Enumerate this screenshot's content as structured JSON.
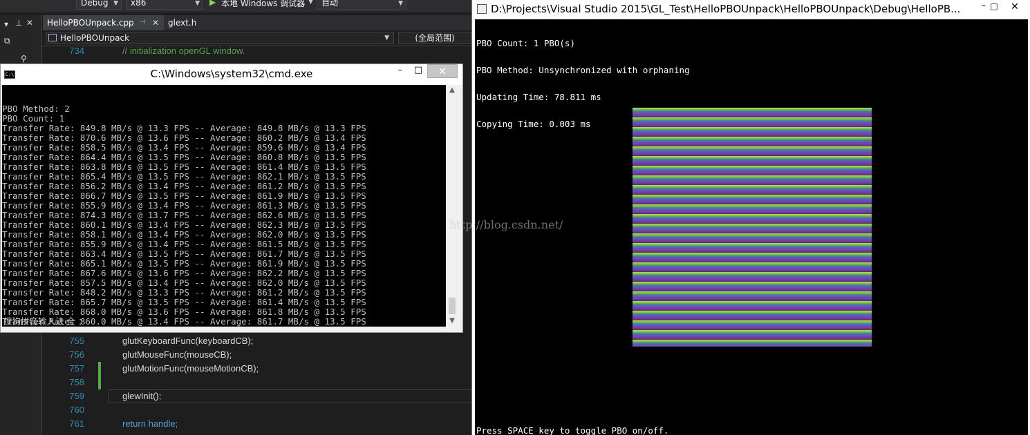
{
  "vs": {
    "toolbar": {
      "config": "Debug",
      "platform": "x86",
      "debugger": "本地 Windows 调试器",
      "auto": "自动"
    },
    "tabs": [
      {
        "label": "HelloPBOUnpack.cpp"
      },
      {
        "label": "glext.h"
      }
    ],
    "nav": {
      "project": "HelloPBOUnpack",
      "scope": "(全局范围)"
    },
    "code_top": {
      "ln": "734",
      "text": "// initialization openGL window."
    },
    "code_lines": [
      {
        "ln": "755",
        "text": "glutKeyboardFunc(keyboardCB);"
      },
      {
        "ln": "756",
        "text": "glutMouseFunc(mouseCB);"
      },
      {
        "ln": "757",
        "text": "glutMotionFunc(mouseMotionCB);"
      },
      {
        "ln": "758",
        "text": ""
      },
      {
        "ln": "759",
        "text": "glewInit();"
      },
      {
        "ln": "760",
        "text": ""
      },
      {
        "ln": "761",
        "text": "return handle;"
      }
    ]
  },
  "cmd": {
    "title": "C:\\Windows\\system32\\cmd.exe",
    "icon": "C:\\",
    "lines": [
      "PBO Method: 2",
      "PBO Count: 1",
      "Transfer Rate: 849.8 MB/s @ 13.3 FPS -- Average: 849.8 MB/s @ 13.3 FPS",
      "Transfer Rate: 870.6 MB/s @ 13.6 FPS -- Average: 860.2 MB/s @ 13.4 FPS",
      "Transfer Rate: 858.5 MB/s @ 13.4 FPS -- Average: 859.6 MB/s @ 13.4 FPS",
      "Transfer Rate: 864.4 MB/s @ 13.5 FPS -- Average: 860.8 MB/s @ 13.5 FPS",
      "Transfer Rate: 863.8 MB/s @ 13.5 FPS -- Average: 861.4 MB/s @ 13.5 FPS",
      "Transfer Rate: 865.4 MB/s @ 13.5 FPS -- Average: 862.1 MB/s @ 13.5 FPS",
      "Transfer Rate: 856.2 MB/s @ 13.4 FPS -- Average: 861.2 MB/s @ 13.5 FPS",
      "Transfer Rate: 866.7 MB/s @ 13.5 FPS -- Average: 861.9 MB/s @ 13.5 FPS",
      "Transfer Rate: 855.9 MB/s @ 13.4 FPS -- Average: 861.3 MB/s @ 13.5 FPS",
      "Transfer Rate: 874.3 MB/s @ 13.7 FPS -- Average: 862.6 MB/s @ 13.5 FPS",
      "Transfer Rate: 860.1 MB/s @ 13.4 FPS -- Average: 862.3 MB/s @ 13.5 FPS",
      "Transfer Rate: 858.1 MB/s @ 13.4 FPS -- Average: 862.0 MB/s @ 13.5 FPS",
      "Transfer Rate: 855.9 MB/s @ 13.4 FPS -- Average: 861.5 MB/s @ 13.5 FPS",
      "Transfer Rate: 863.4 MB/s @ 13.5 FPS -- Average: 861.7 MB/s @ 13.5 FPS",
      "Transfer Rate: 865.1 MB/s @ 13.5 FPS -- Average: 861.9 MB/s @ 13.5 FPS",
      "Transfer Rate: 867.6 MB/s @ 13.6 FPS -- Average: 862.2 MB/s @ 13.5 FPS",
      "Transfer Rate: 857.5 MB/s @ 13.4 FPS -- Average: 862.0 MB/s @ 13.5 FPS",
      "Transfer Rate: 848.2 MB/s @ 13.3 FPS -- Average: 861.2 MB/s @ 13.5 FPS",
      "Transfer Rate: 865.7 MB/s @ 13.5 FPS -- Average: 861.4 MB/s @ 13.5 FPS",
      "Transfer Rate: 868.0 MB/s @ 13.6 FPS -- Average: 861.8 MB/s @ 13.5 FPS",
      "Transfer Rate: 860.0 MB/s @ 13.4 FPS -- Average: 861.7 MB/s @ 13.5 FPS"
    ],
    "ime": "搜狗拼音输入法 全 ："
  },
  "gl": {
    "title": "D:\\Projects\\Visual Studio 2015\\GL_Test\\HelloPBOUnpack\\HelloPBOUnpack\\Debug\\HelloPB...",
    "info": [
      "PBO Count: 1 PBO(s)",
      "PBO Method: Unsynchronized with orphaning",
      "Updating Time: 78.811 ms",
      "Copying Time: 0.003 ms"
    ],
    "footer": "Press SPACE key to toggle PBO on/off."
  },
  "watermark": "http://blog.csdn.net/",
  "colors": {
    "vs_background": "#1e1e1e",
    "line_number": "#2b91af",
    "comment": "#57a64a",
    "console_text": "#c0c0c0"
  }
}
